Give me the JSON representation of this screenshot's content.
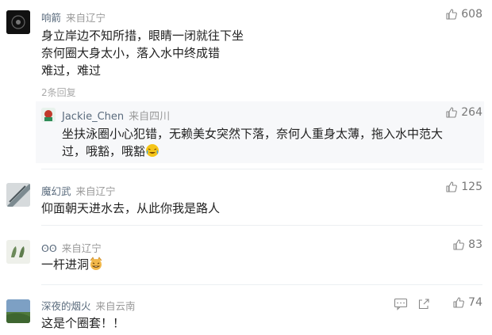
{
  "comments": [
    {
      "user": "响箭",
      "location": "来自辽宁",
      "lines": [
        "身立岸边不知所措，眼睛一闭就往下坐",
        "奈何圈大身太小，落入水中终成错",
        "难过，难过"
      ],
      "likes": "608",
      "more_replies": "2条回复",
      "reply": {
        "user": "Jackie_Chen",
        "location": "来自四川",
        "lines": [
          "坐扶泳圈小心犯错，无赖美女突然下落，奈何人重身太薄，拖入水中范大",
          "过，哦豁，哦豁"
        ],
        "likes": "264",
        "emoji": "crying-laugh-emoji"
      }
    },
    {
      "user": "魔幻武",
      "location": "来自辽宁",
      "lines": [
        "仰面朝天进水去，从此你我是路人"
      ],
      "likes": "125"
    },
    {
      "user": "ʘʘ",
      "location": "来自辽宁",
      "lines": [
        "一杆进洞"
      ],
      "likes": "83",
      "emoji": "cat-grin-emoji"
    },
    {
      "user": "深夜的烟火",
      "location": "来自云南",
      "lines": [
        "这是个圈套！！"
      ],
      "likes": "74"
    }
  ],
  "colors": {
    "username": "#5a6b7d",
    "location": "#999999",
    "text": "#222222",
    "separator": "#eceff2",
    "reply_bg": "#f7f8fa"
  }
}
